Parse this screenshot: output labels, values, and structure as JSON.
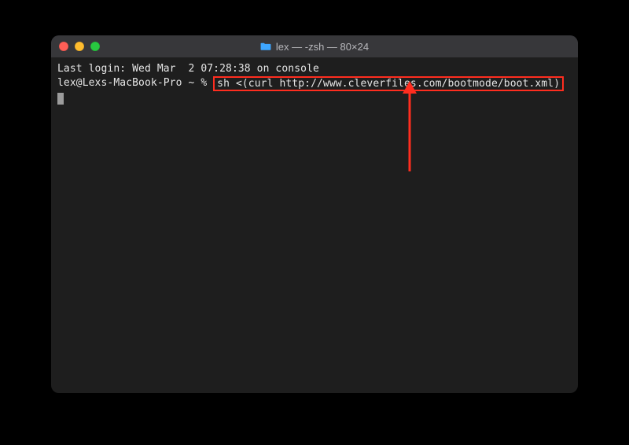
{
  "window": {
    "title": "lex — -zsh — 80×24"
  },
  "terminal": {
    "last_login": "Last login: Wed Mar  2 07:28:38 on console",
    "prompt": "lex@Lexs-MacBook-Pro ~ % ",
    "command": "sh <(curl http://www.cleverfiles.com/bootmode/boot.xml)"
  },
  "annotation": {
    "highlight_color": "#ff2d1f"
  }
}
